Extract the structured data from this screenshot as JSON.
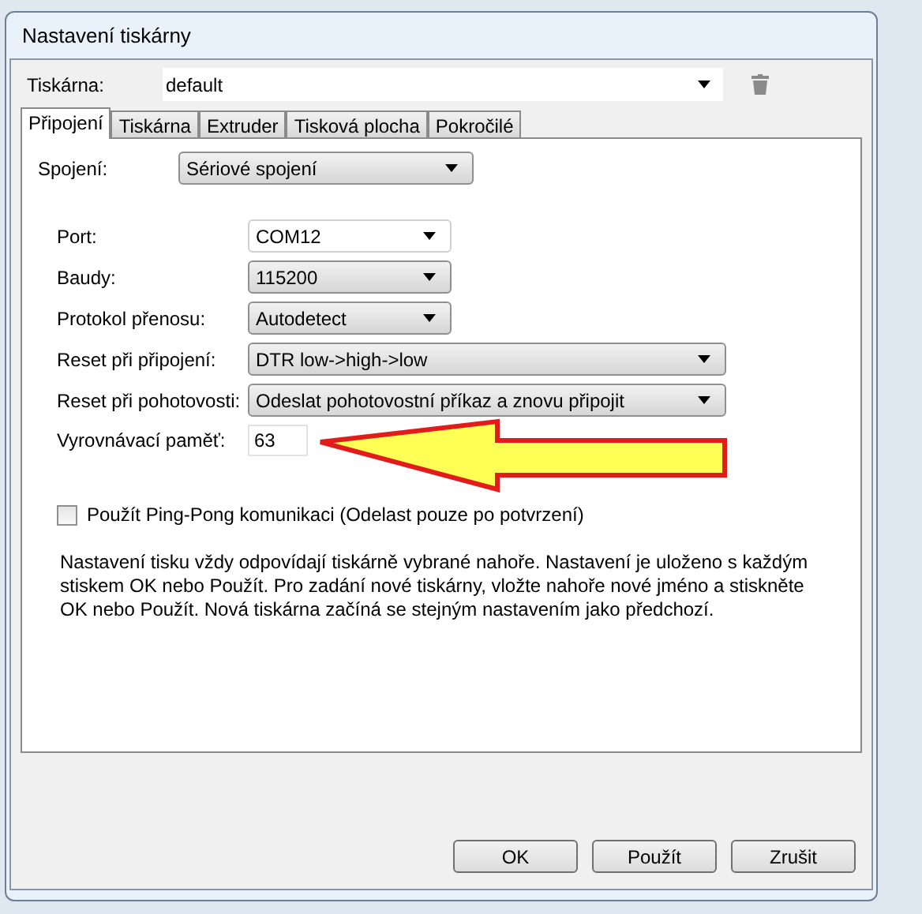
{
  "window": {
    "title": "Nastavení tiskárny"
  },
  "printer": {
    "label": "Tiskárna:",
    "value": "default"
  },
  "tabs": [
    {
      "label": "Připojení",
      "selected": true
    },
    {
      "label": "Tiskárna",
      "selected": false
    },
    {
      "label": "Extruder",
      "selected": false
    },
    {
      "label": "Tisková plocha",
      "selected": false
    },
    {
      "label": "Pokročilé",
      "selected": false
    }
  ],
  "connection": {
    "label": "Spojení:",
    "value": "Sériové spojení"
  },
  "fields": [
    {
      "label": "Port:",
      "value": "COM12",
      "kind": "combo"
    },
    {
      "label": "Baudy:",
      "value": "115200",
      "kind": "combo"
    },
    {
      "label": "Protokol přenosu:",
      "value": "Autodetect",
      "kind": "combo"
    },
    {
      "label": "Reset při připojení:",
      "value": "DTR low->high->low",
      "kind": "wide-combo"
    },
    {
      "label": "Reset při pohotovosti:",
      "value": "Odeslat pohotovostní příkaz a znovu připojit",
      "kind": "wide-combo"
    },
    {
      "label": "Vyrovnávací paměť:",
      "value": "63",
      "kind": "text"
    }
  ],
  "ping_pong": {
    "label": "Použít Ping-Pong komunikaci (Odelast pouze po potvrzení)",
    "checked": false
  },
  "note": "Nastavení tisku vždy odpovídají tiskárně vybrané nahoře. Nastavení je uloženo s každým stiskem OK nebo Použít. Pro zadání nové tiskárny, vložte nahoře nové jméno a stiskněte OK nebo Použít. Nová tiskárna začíná se stejným nastavením jako předchozí.",
  "buttons": [
    "OK",
    "Použít",
    "Zrušit"
  ]
}
